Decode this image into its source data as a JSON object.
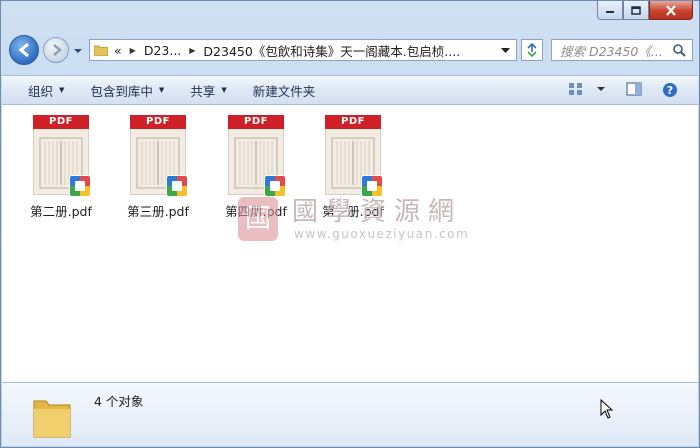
{
  "window": {
    "caption_buttons": [
      "minimize",
      "maximize",
      "close"
    ]
  },
  "nav": {
    "address": {
      "overflow": "«",
      "crumbs": [
        "D23...",
        "D23450《包飲和诗集》天一阁藏本.包启桢...."
      ]
    },
    "search_placeholder": "搜索 D23450《...",
    "icons": {
      "back": "back-arrow-icon",
      "forward": "forward-arrow-icon",
      "refresh": "refresh-icon",
      "search": "search-icon"
    }
  },
  "toolbar": {
    "organize": "组织",
    "include_library": "包含到库中",
    "share": "共享",
    "new_folder": "新建文件夹",
    "right_icons": [
      "view-options-icon",
      "preview-pane-icon",
      "help-icon"
    ]
  },
  "files": [
    {
      "name": "第二册.pdf",
      "badge": "PDF"
    },
    {
      "name": "第三册.pdf",
      "badge": "PDF"
    },
    {
      "name": "第四册.pdf",
      "badge": "PDF"
    },
    {
      "name": "第一册.pdf",
      "badge": "PDF"
    }
  ],
  "watermark": {
    "seal": "国",
    "title": "國學資源網",
    "url": "www.guoxueziyuan.com"
  },
  "details": {
    "count_text": "4 个对象"
  },
  "colors": {
    "pdf_red": "#cf2027",
    "window_frame": "#c2d6ee",
    "accent_blue": "#2e6cc0"
  }
}
